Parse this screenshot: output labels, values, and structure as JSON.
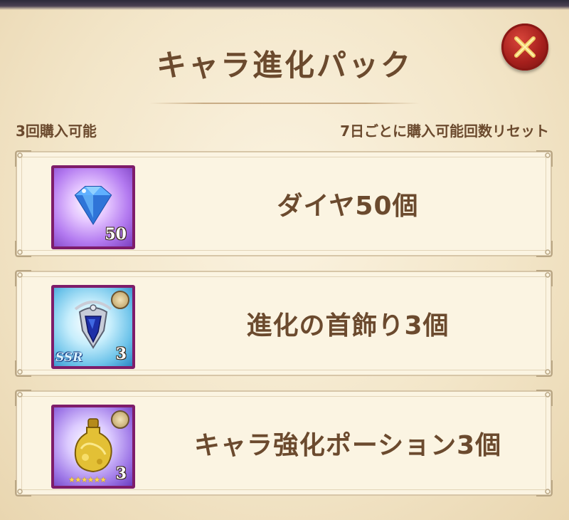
{
  "header": {
    "title": "キャラ進化パック",
    "close_icon": "close-x-icon"
  },
  "purchase_info": {
    "limit_text": "3回購入可能",
    "reset_text": "7日ごとに購入可能回数リセット"
  },
  "items": [
    {
      "name": "ダイヤ50個",
      "quantity": "50",
      "icon": "blue-diamond-icon",
      "frame_color": "#7e1c6a"
    },
    {
      "name": "進化の首飾り3個",
      "quantity": "3",
      "icon": "evolution-necklace-icon",
      "rarity_icon": "ssr-emblem-icon",
      "badge_icon": "crest-badge-icon"
    },
    {
      "name": "キャラ強化ポーション3個",
      "quantity": "3",
      "icon": "gold-potion-icon",
      "stars": "★★★★★★",
      "badge_icon": "scroll-badge-icon"
    }
  ],
  "colors": {
    "text_brown": "#6b4a2e",
    "parchment": "#f3e6c9",
    "close_red": "#a51f1c"
  }
}
